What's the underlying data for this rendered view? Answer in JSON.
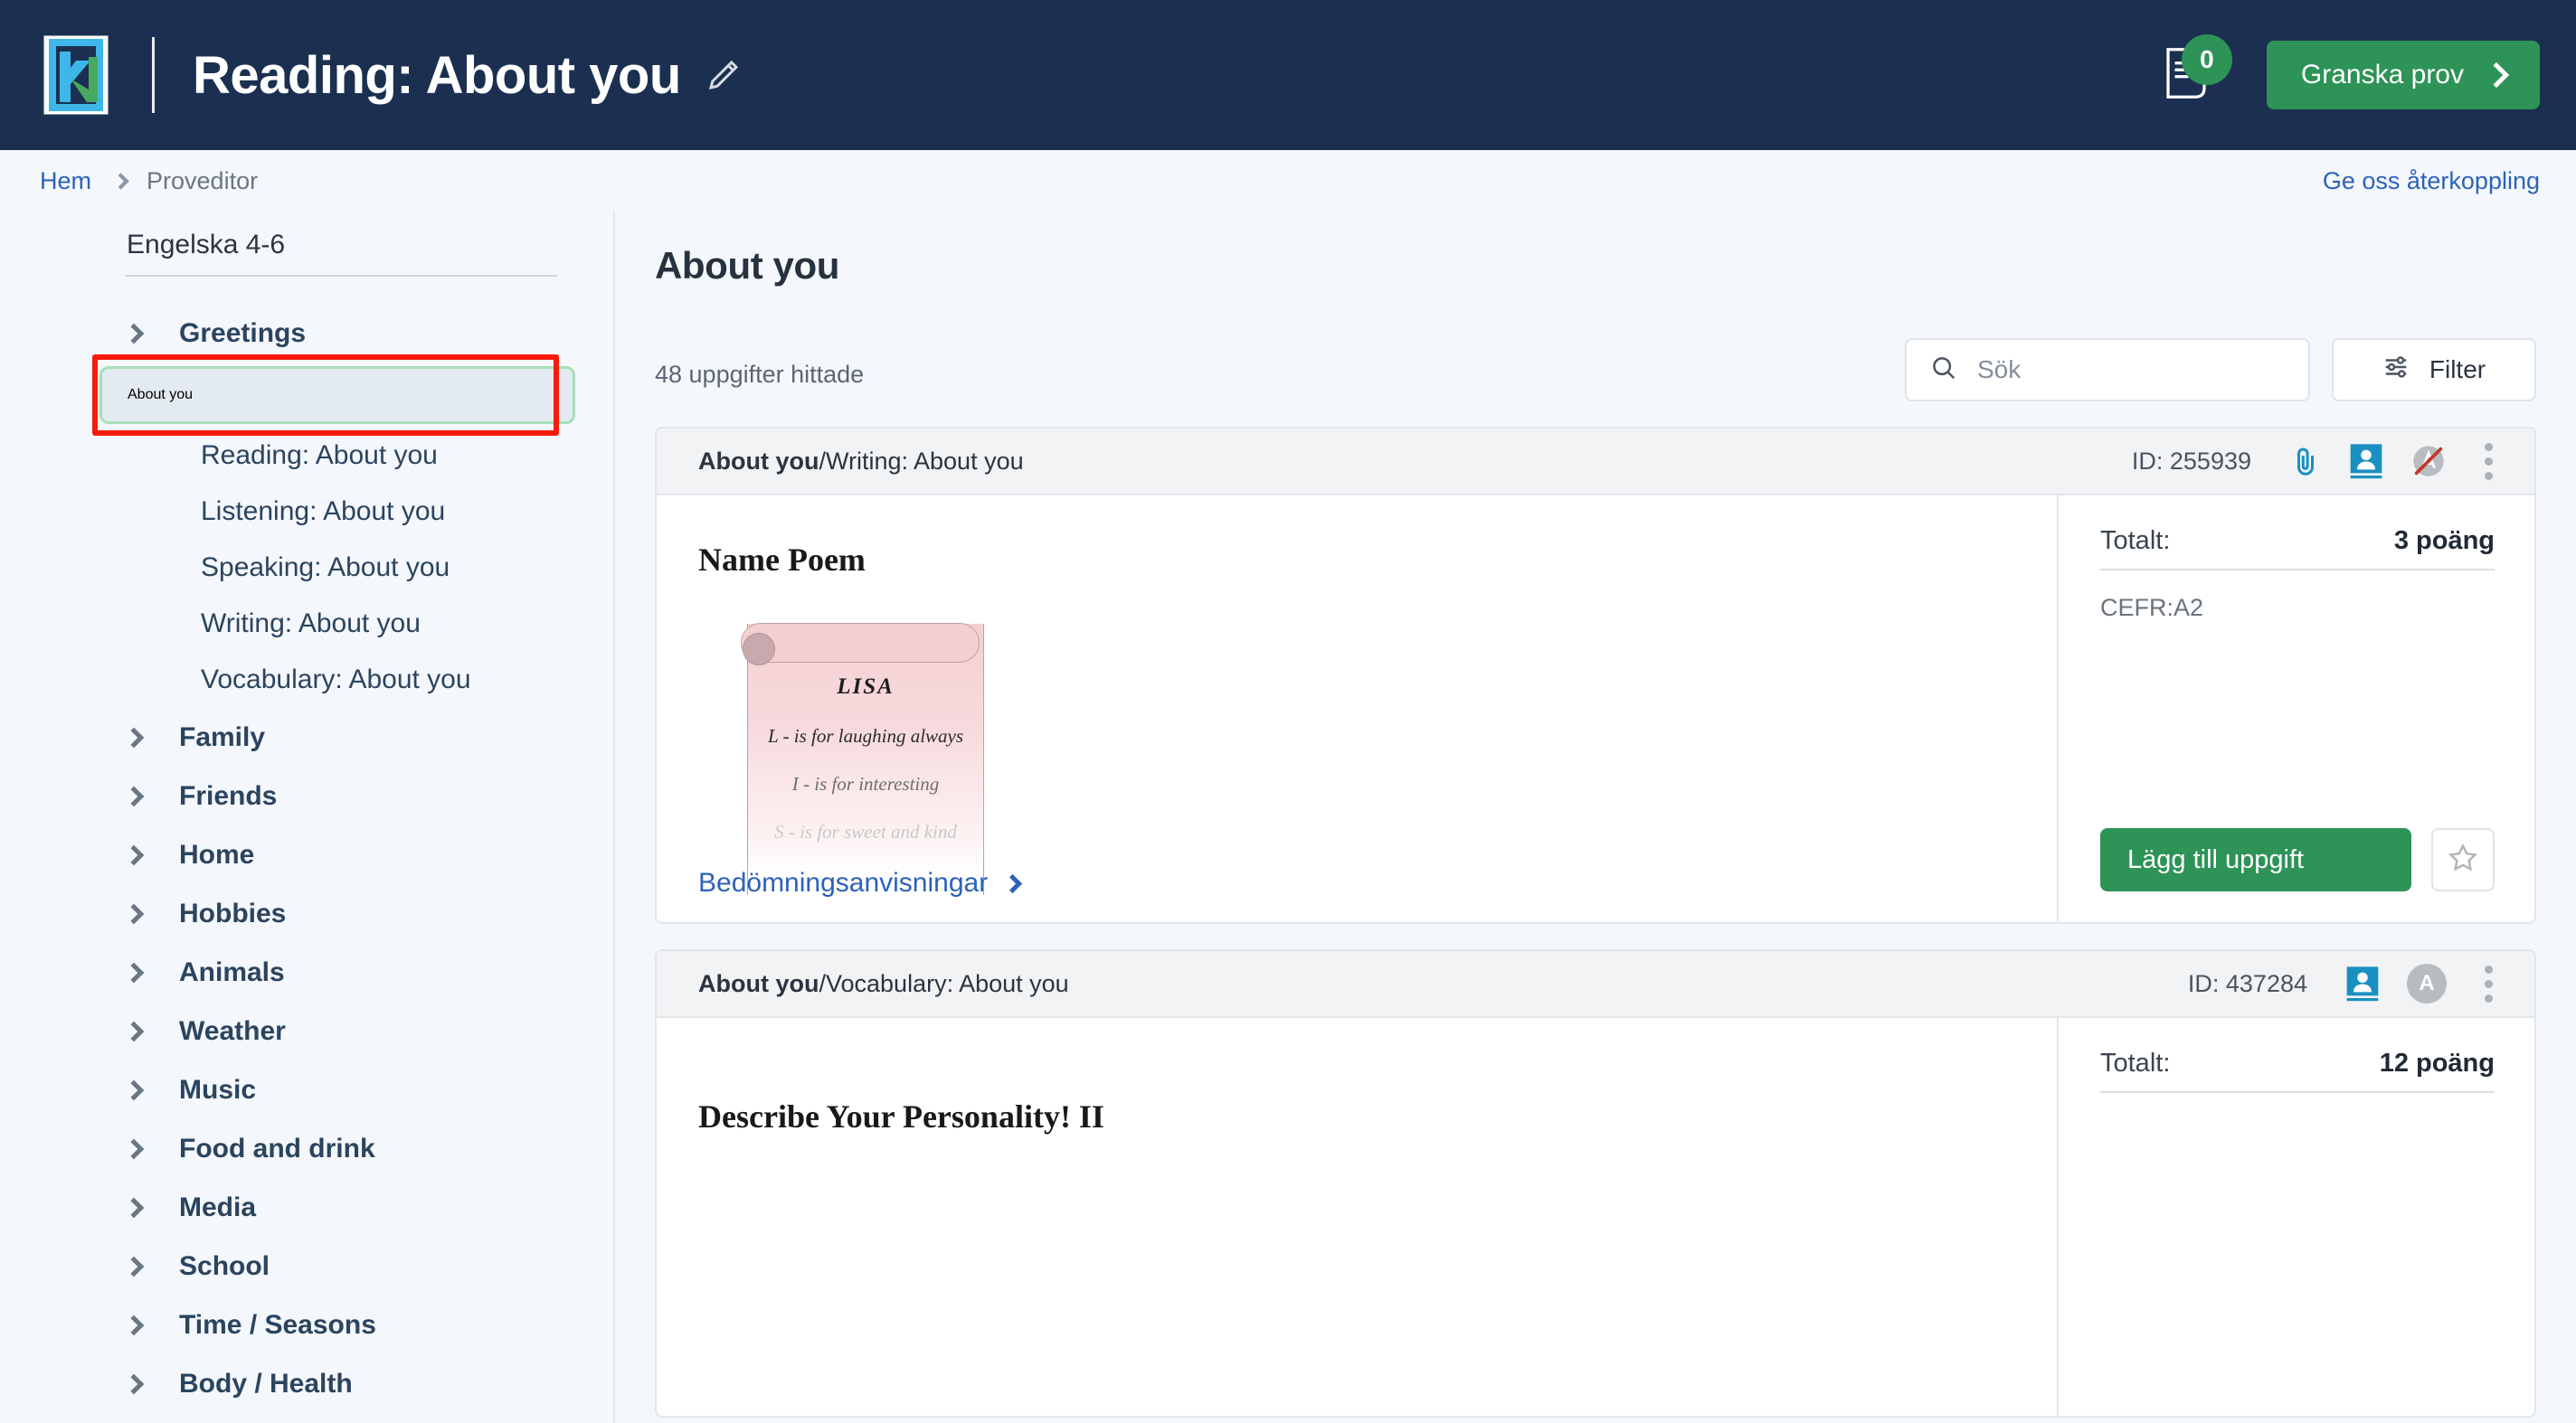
{
  "header": {
    "logo_name": "km-logo",
    "title": "Reading: About you",
    "edit_icon": "pencil-icon",
    "doc_icon": "document-icon",
    "doc_badge_count": "0",
    "review_button_label": "Granska prov"
  },
  "breadcrumb": {
    "home": "Hem",
    "current": "Proveditor",
    "feedback": "Ge oss återkoppling"
  },
  "sidebar": {
    "course": "Engelska 4-6",
    "items": [
      {
        "label": "Greetings",
        "expanded": false,
        "selected": false
      },
      {
        "label": "About you",
        "expanded": true,
        "selected": true
      },
      {
        "label": "Family",
        "expanded": false,
        "selected": false
      },
      {
        "label": "Friends",
        "expanded": false,
        "selected": false
      },
      {
        "label": "Home",
        "expanded": false,
        "selected": false
      },
      {
        "label": "Hobbies",
        "expanded": false,
        "selected": false
      },
      {
        "label": "Animals",
        "expanded": false,
        "selected": false
      },
      {
        "label": "Weather",
        "expanded": false,
        "selected": false
      },
      {
        "label": "Music",
        "expanded": false,
        "selected": false
      },
      {
        "label": "Food and drink",
        "expanded": false,
        "selected": false
      },
      {
        "label": "Media",
        "expanded": false,
        "selected": false
      },
      {
        "label": "School",
        "expanded": false,
        "selected": false
      },
      {
        "label": "Time / Seasons",
        "expanded": false,
        "selected": false
      },
      {
        "label": "Body / Health",
        "expanded": false,
        "selected": false
      }
    ],
    "sub_items": [
      "Reading: About you",
      "Listening: About you",
      "Speaking: About you",
      "Writing: About you",
      "Vocabulary: About you"
    ]
  },
  "main": {
    "title": "About you",
    "found_count": "48 uppgifter hittade",
    "search_placeholder": "Sök",
    "search_value": "",
    "search_icon": "search-icon",
    "filter_label": "Filter",
    "filter_icon": "sliders-icon"
  },
  "cards": [
    {
      "path_bold": "About you",
      "path_rest": "/Writing: About you",
      "id_label": "ID: 255939",
      "icons": [
        "paperclip-icon",
        "id-card-icon",
        "no-ai-icon",
        "kebab-menu-icon"
      ],
      "task_title": "Name Poem",
      "guide_link": "Bedömningsanvisningar",
      "totals_label": "Totalt:",
      "totals_value": "3 poäng",
      "cefr": "CEFR:A2",
      "add_button_label": "Lägg till uppgift",
      "star_icon": "star-outline-icon",
      "poem": {
        "name": "LISA",
        "lines": [
          "L - is for laughing always",
          "I - is for interesting",
          "S - is for sweet and kind"
        ]
      }
    },
    {
      "path_bold": "About you",
      "path_rest": "/Vocabulary: About you",
      "id_label": "ID: 437284",
      "icons": [
        "id-card-icon",
        "avatar-a-icon",
        "kebab-menu-icon"
      ],
      "avatar_letter": "A",
      "task_title": "Describe Your Personality! II",
      "totals_label": "Totalt:",
      "totals_value": "12 poäng"
    }
  ],
  "colors": {
    "header_bg": "#1b3050",
    "accent_green": "#2e9357",
    "link_blue": "#2d62ba",
    "page_bg": "#f4f7fb",
    "annotation_red": "#f81b0b",
    "selected_border_green": "#a7dfb9",
    "logo_blue": "#3fb6e8",
    "logo_green": "#47a95f"
  }
}
